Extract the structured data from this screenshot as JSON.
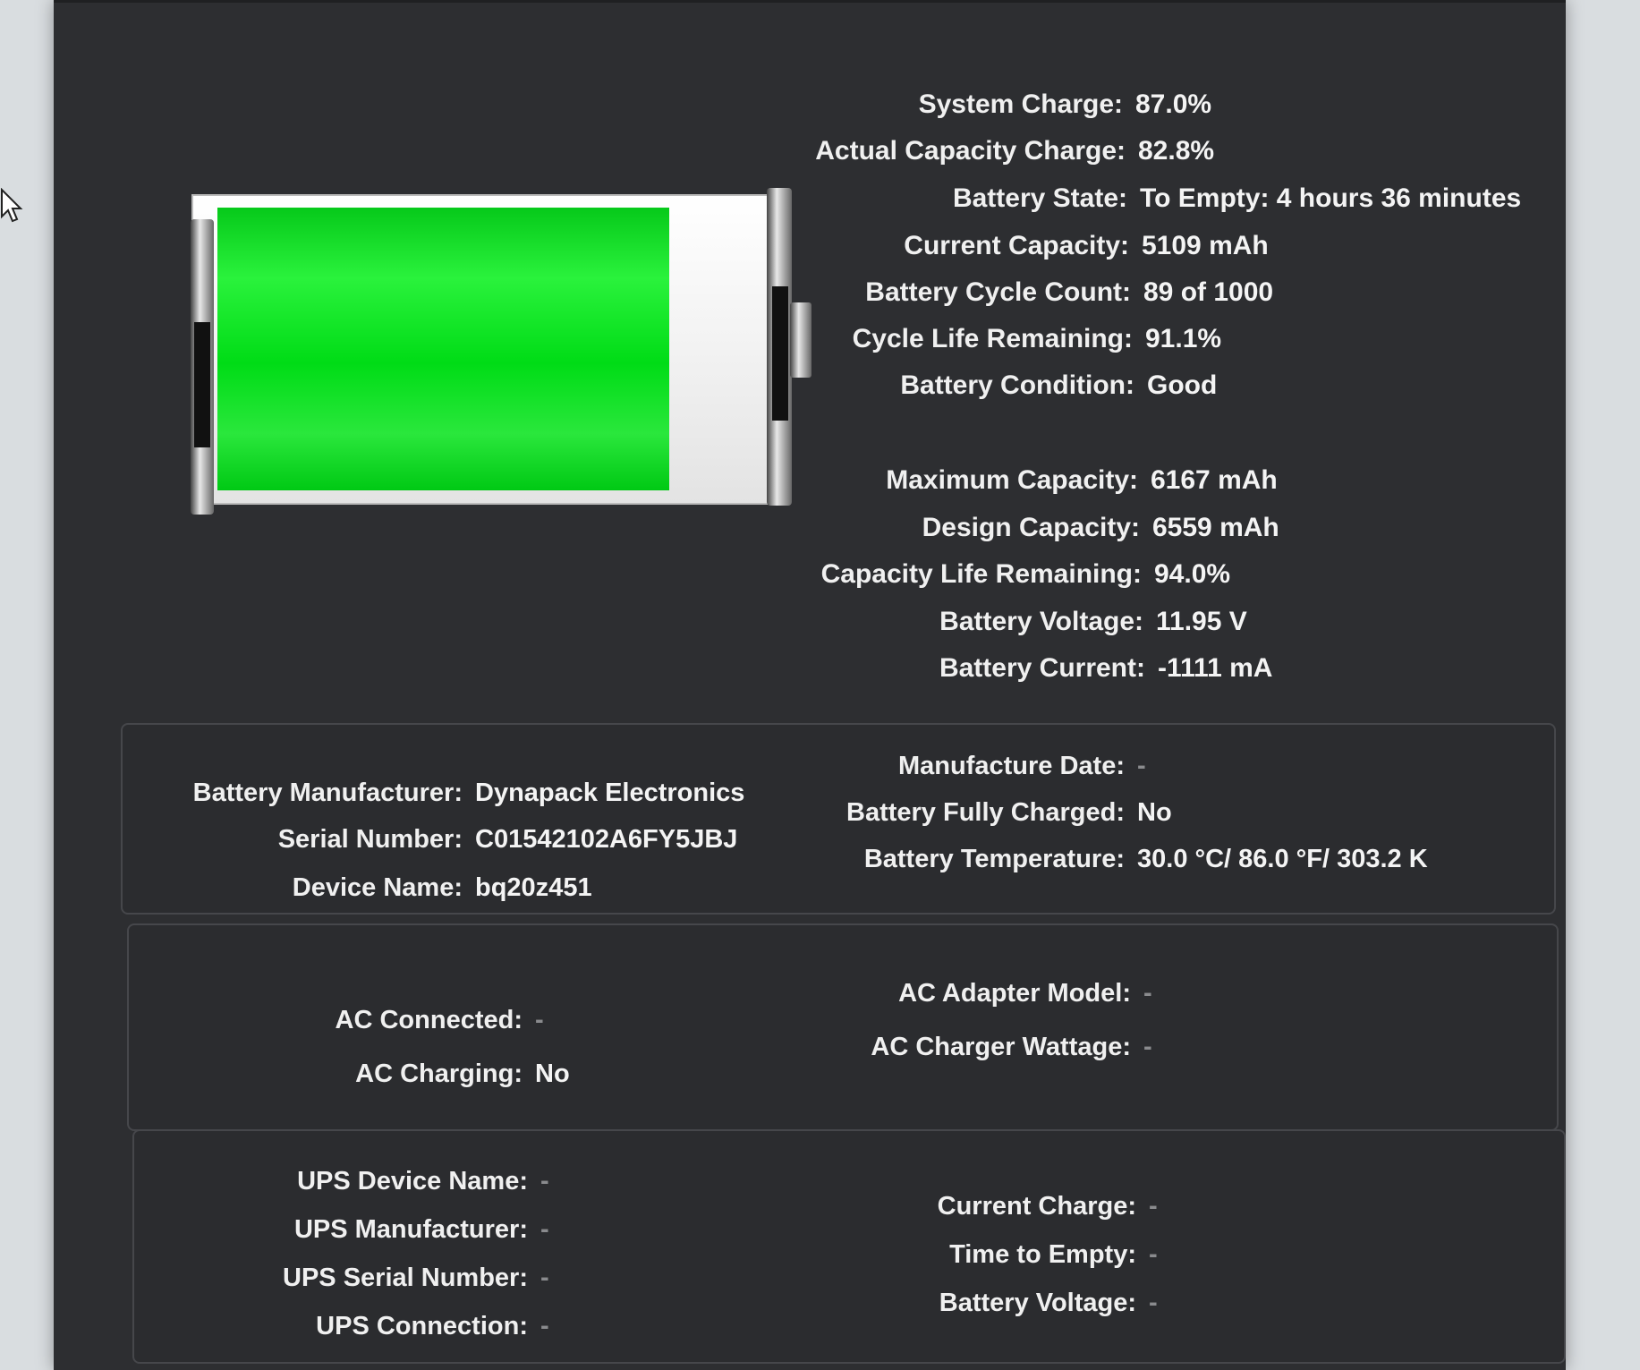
{
  "cursor": {
    "icon": "mouse-pointer-icon"
  },
  "battery_graphic": {
    "icon": "battery-icon",
    "charge_fraction": 0.828,
    "fill_color": "#00e21a"
  },
  "summary": [
    {
      "label": "System Charge:",
      "value": "87.0%"
    },
    {
      "label": "Actual Capacity Charge:",
      "value": "82.8%"
    },
    {
      "label": "Battery State:",
      "value": "To Empty: 4 hours 36 minutes"
    },
    {
      "label": "Current Capacity:",
      "value": "5109 mAh"
    },
    {
      "label": "Battery Cycle Count:",
      "value": "89 of 1000"
    },
    {
      "label": "Cycle Life Remaining:",
      "value": "91.1%"
    },
    {
      "label": "Battery Condition:",
      "value": "Good"
    }
  ],
  "capacity": [
    {
      "label": "Maximum Capacity:",
      "value": "6167 mAh"
    },
    {
      "label": "Design Capacity:",
      "value": "6559 mAh"
    },
    {
      "label": "Capacity Life Remaining:",
      "value": "94.0%"
    },
    {
      "label": "Battery Voltage:",
      "value": "11.95 V"
    },
    {
      "label": "Battery Current:",
      "value": "-1111 mA"
    }
  ],
  "battery_info": {
    "left": [
      {
        "label": "Battery Manufacturer:",
        "value": "Dynapack Electronics"
      },
      {
        "label": "Serial Number:",
        "value": "C01542102A6FY5JBJ"
      },
      {
        "label": "Device Name:",
        "value": "bq20z451"
      }
    ],
    "right": [
      {
        "label": "Manufacture Date:",
        "value": "-"
      },
      {
        "label": "Battery Fully Charged:",
        "value": "No"
      },
      {
        "label": "Battery Temperature:",
        "value": "30.0 °C/ 86.0 °F/ 303.2 K"
      }
    ]
  },
  "ac_info": {
    "left": [
      {
        "label": "AC Connected:",
        "value": "-"
      },
      {
        "label": "AC Charging:",
        "value": "No"
      }
    ],
    "right": [
      {
        "label": "AC Adapter Model:",
        "value": "-"
      },
      {
        "label": "AC Charger Wattage:",
        "value": "-"
      }
    ]
  },
  "ups_info": {
    "left": [
      {
        "label": "UPS Device Name:",
        "value": "-"
      },
      {
        "label": "UPS Manufacturer:",
        "value": "-"
      },
      {
        "label": "UPS Serial Number:",
        "value": "-"
      },
      {
        "label": "UPS Connection:",
        "value": "-"
      }
    ],
    "right": [
      {
        "label": "Current Charge:",
        "value": "-"
      },
      {
        "label": "Time to Empty:",
        "value": "-"
      },
      {
        "label": "Battery Voltage:",
        "value": "-"
      }
    ]
  }
}
